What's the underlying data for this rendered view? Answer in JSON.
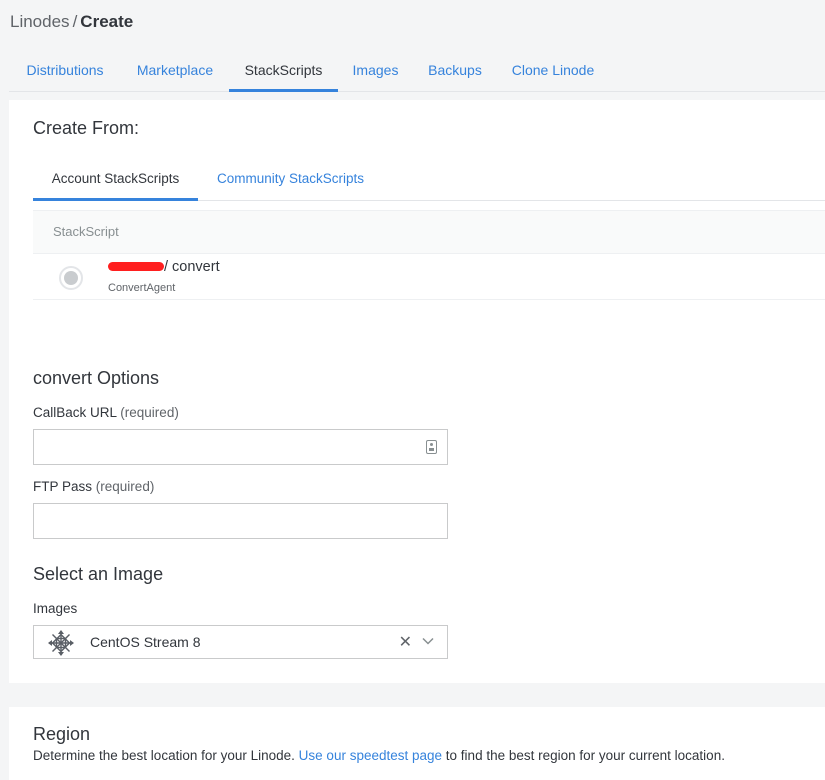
{
  "breadcrumb": {
    "parent": "Linodes",
    "separator": "/",
    "current": "Create"
  },
  "top_tabs": [
    {
      "label": "Distributions"
    },
    {
      "label": "Marketplace"
    },
    {
      "label": "StackScripts",
      "active": true
    },
    {
      "label": "Images"
    },
    {
      "label": "Backups"
    },
    {
      "label": "Clone Linode"
    }
  ],
  "create_from": {
    "heading": "Create From:",
    "tabs": [
      {
        "label": "Account StackScripts",
        "active": true
      },
      {
        "label": "Community StackScripts"
      }
    ],
    "table_header": "StackScript",
    "rows": [
      {
        "title": "/ convert",
        "subtitle": "ConvertAgent",
        "selected": false
      }
    ]
  },
  "options": {
    "heading": "convert Options",
    "fields": [
      {
        "label": "CallBack URL",
        "required": "(required)",
        "value": ""
      },
      {
        "label": "FTP Pass",
        "required": "(required)",
        "value": ""
      }
    ]
  },
  "image": {
    "heading": "Select an Image",
    "label": "Images",
    "selected": "CentOS Stream 8",
    "icon": "centos-icon"
  },
  "region": {
    "heading": "Region",
    "desc_before": "Determine the best location for your Linode.",
    "link": "Use our speedtest page",
    "desc_after": "to find the best region for your current location."
  },
  "colors": {
    "accent": "#3683dc",
    "redaction": "#ff1f1f",
    "background": "#f4f5f6"
  }
}
